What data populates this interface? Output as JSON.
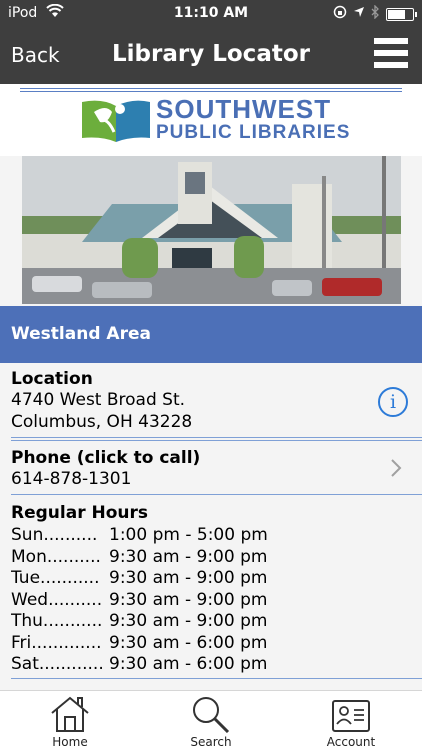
{
  "status": {
    "carrier": "iPod",
    "time": "11:10 AM",
    "battery_level": 0.75
  },
  "nav": {
    "back_label": "Back",
    "title": "Library Locator"
  },
  "logo": {
    "line1": "SOUTHWEST",
    "line2": "PUBLIC LIBRARIES"
  },
  "area": {
    "name": "Westland Area"
  },
  "location": {
    "heading": "Location",
    "line1": "4740 West Broad St.",
    "line2": "Columbus, OH 43228"
  },
  "phone": {
    "heading": "Phone (click to call)",
    "number": "614-878-1301"
  },
  "hours": {
    "heading": "Regular Hours",
    "rows": [
      {
        "day": "Sun..........",
        "time": "1:00 pm - 5:00 pm"
      },
      {
        "day": "Mon..........",
        "time": "9:30 am - 9:00 pm"
      },
      {
        "day": "Tue...........",
        "time": "9:30 am - 9:00 pm"
      },
      {
        "day": "Wed..........",
        "time": "9:30 am - 9:00 pm"
      },
      {
        "day": "Thu............",
        "time": "9:30 am - 9:00 pm"
      },
      {
        "day": "Fri.............",
        "time": "9:30 am - 6:00 pm"
      },
      {
        "day": "Sat............",
        "time": "9:30 am - 6:00 pm"
      }
    ]
  },
  "tabs": [
    {
      "label": "Home",
      "icon": "home-icon"
    },
    {
      "label": "Search",
      "icon": "search-icon"
    },
    {
      "label": "Account",
      "icon": "account-card-icon"
    }
  ]
}
